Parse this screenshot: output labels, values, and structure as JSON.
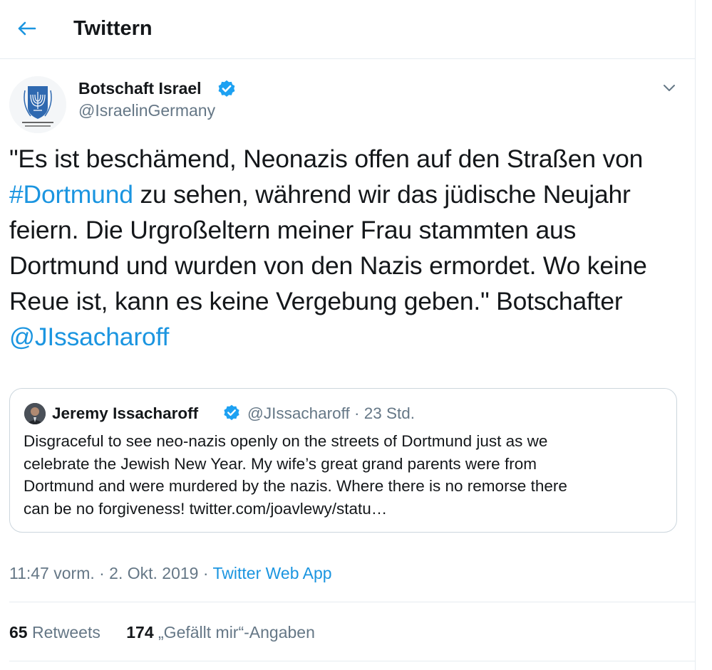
{
  "header": {
    "title": "Twittern",
    "back_icon": "arrow-left-icon"
  },
  "colors": {
    "accent": "#1b95e0",
    "muted": "#657786",
    "text": "#14171a",
    "border": "#e6ecf0"
  },
  "tweet": {
    "author_name": "Botschaft Israel",
    "author_handle": "@IsraelinGermany",
    "avatar_caption": "BOTSCHAFT ISRAEL IN DEUTSCHLAND",
    "text": {
      "line1": "\"Es ist beschämend, Neonazis offen auf den Straßen von",
      "hashtag": "#Dortmund",
      "line2_rest": " zu sehen, während wir das jüdische Neujahr",
      "line3": "feiern. Die Urgroßeltern meiner Frau stammten aus",
      "line4": "Dortmund und wurden von den Nazis ermordet. Wo keine",
      "line5": "Reue ist, kann es keine Vergebung geben.\" Botschafter",
      "mention": "@JIssacharoff"
    },
    "timestamp": "11:47 vorm. · 2. Okt. 2019 · ",
    "source_app": "Twitter Web App",
    "retweets_count": "65",
    "retweets_label": " Retweets",
    "likes_count": "174",
    "likes_label": " „Gefällt mir“-Angaben"
  },
  "quote": {
    "author_name": "Jeremy Issacharoff",
    "meta": "@JIssacharoff · 23 Std.",
    "lines": [
      "Disgraceful to see neo-nazis openly on the streets of Dortmund just as we",
      "celebrate the Jewish New Year. My wife’s great grand parents were from",
      "Dortmund and were murdered by the nazis. Where there is no remorse there",
      "can be no forgiveness! twitter.com/joavlewy/statu…"
    ]
  }
}
